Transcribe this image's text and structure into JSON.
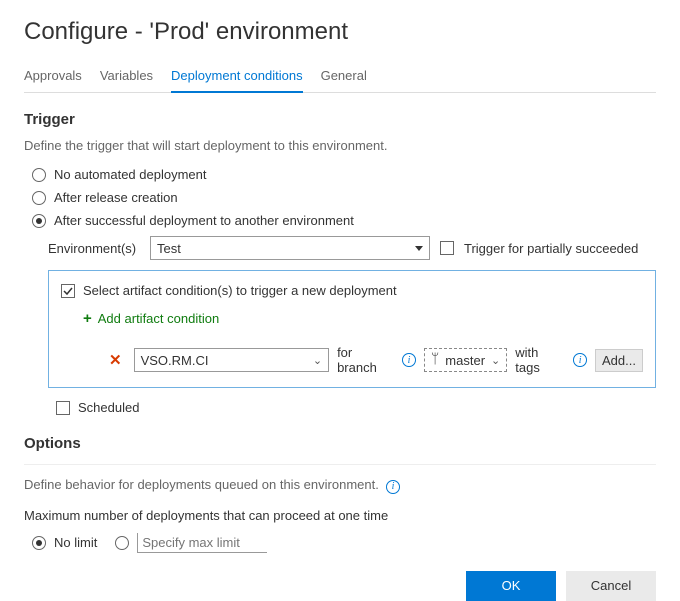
{
  "page_title": "Configure - 'Prod' environment",
  "tabs": {
    "approvals": "Approvals",
    "variables": "Variables",
    "deployment_conditions": "Deployment conditions",
    "general": "General"
  },
  "trigger": {
    "header": "Trigger",
    "desc": "Define the trigger that will start deployment to this environment.",
    "options": {
      "no_auto": "No automated deployment",
      "after_release": "After release creation",
      "after_success": "After successful deployment to another environment"
    },
    "environments_label": "Environment(s)",
    "environment_selected": "Test",
    "trigger_partial_label": "Trigger for partially succeeded",
    "artifact": {
      "select_label": "Select artifact condition(s) to trigger a new deployment",
      "add_label": "Add artifact condition",
      "condition": {
        "source": "VSO.RM.CI",
        "for_branch": "for branch",
        "branch": "master",
        "with_tags": "with tags",
        "add_btn": "Add..."
      }
    },
    "scheduled_label": "Scheduled"
  },
  "options": {
    "header": "Options",
    "desc": "Define behavior for deployments queued on this environment.",
    "max_label": "Maximum number of deployments that can proceed at one time",
    "no_limit": "No limit",
    "specify_placeholder": "Specify max limit"
  },
  "footer": {
    "ok": "OK",
    "cancel": "Cancel"
  }
}
